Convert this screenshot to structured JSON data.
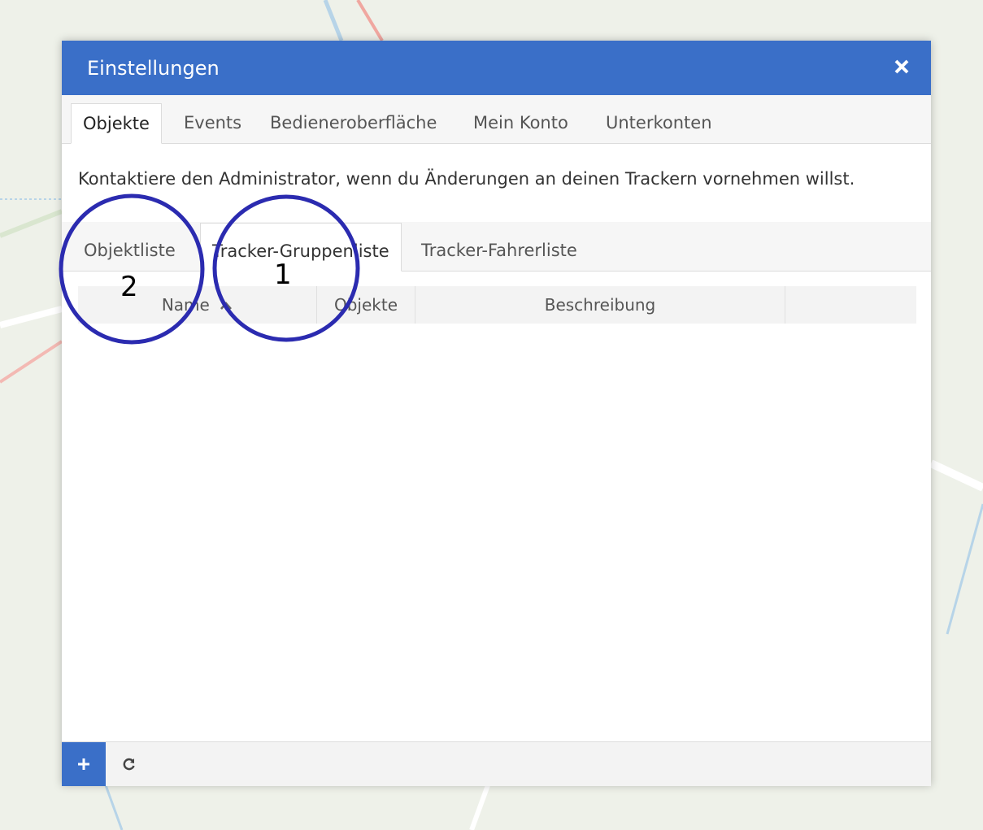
{
  "dialog": {
    "title": "Einstellungen",
    "close_icon": "close-icon"
  },
  "main_tabs": [
    {
      "label": "Objekte",
      "active": true
    },
    {
      "label": "Events",
      "active": false
    },
    {
      "label": "Bedieneroberfläche",
      "active": false
    },
    {
      "label": "Mein Konto",
      "active": false
    },
    {
      "label": "Unterkonten",
      "active": false
    }
  ],
  "notice": "Kontaktiere den Administrator, wenn du Änderungen an deinen Trackern vornehmen willst.",
  "sub_tabs": [
    {
      "label": "Objektliste",
      "active": false
    },
    {
      "label": "Tracker-Gruppenliste",
      "active": true
    },
    {
      "label": "Tracker-Fahrerliste",
      "active": false
    }
  ],
  "table": {
    "columns": [
      {
        "label": "Name",
        "sort": "ascending"
      },
      {
        "label": "Objekte"
      },
      {
        "label": "Beschreibung"
      },
      {
        "label": ""
      }
    ],
    "rows": []
  },
  "toolbar": {
    "add_icon": "plus-icon",
    "refresh_icon": "refresh-icon"
  },
  "annotations": [
    {
      "label": "1"
    },
    {
      "label": "2"
    }
  ],
  "colors": {
    "accent": "#3a6fc8",
    "annotation_circle": "#2b2bb0"
  }
}
